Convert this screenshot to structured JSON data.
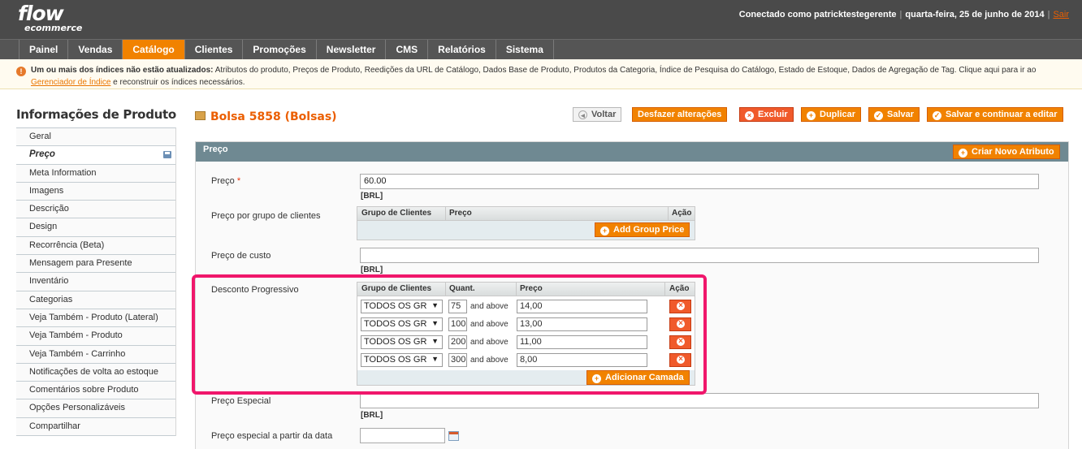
{
  "header": {
    "logo_top": "flow",
    "logo_bottom": "ecommerce",
    "user_text": "Conectado como patricktestegerente",
    "date_text": "quarta-feira, 25 de junho de 2014",
    "logout": "Sair"
  },
  "nav": {
    "items": [
      "Painel",
      "Vendas",
      "Catálogo",
      "Clientes",
      "Promoções",
      "Newsletter",
      "CMS",
      "Relatórios",
      "Sistema"
    ],
    "active": "Catálogo"
  },
  "notice": {
    "bold": "Um ou mais dos índices não estão atualizados:",
    "text": " Atributos do produto, Preços de Produto, Reedições da URL de Catálogo, Dados Base de Produto, Produtos da Categoria, Índice de Pesquisa do Catálogo, Estado de Estoque, Dados de Agregação de Tag. Clique aqui para ir ao ",
    "link": "Gerenciador de Índice",
    "after": " e reconstruir os índices necessários."
  },
  "sidebar": {
    "title": "Informações de Produto",
    "items": [
      "Geral",
      "Preço",
      "Meta Information",
      "Imagens",
      "Descrição",
      "Design",
      "Recorrência (Beta)",
      "Mensagem para Presente",
      "Inventário",
      "Categorias",
      "Veja Também - Produto (Lateral)",
      "Veja Também - Produto",
      "Veja Também - Carrinho",
      "Notificações de volta ao estoque",
      "Comentários sobre Produto",
      "Opções Personalizáveis",
      "Compartilhar"
    ]
  },
  "page": {
    "title": "Bolsa 5858 (Bolsas)",
    "buttons": {
      "back": "Voltar",
      "reset": "Desfazer alterações",
      "delete": "Excluir",
      "duplicate": "Duplicar",
      "save": "Salvar",
      "save_continue": "Salvar e continuar a editar"
    }
  },
  "section": {
    "title": "Preço",
    "create_attribute": "Criar Novo Atributo",
    "price_label": "Preço",
    "price_required": "*",
    "price_value": "60.00",
    "currency_note": "[BRL]",
    "group_price_label": "Preço por grupo de clientes",
    "group_price_headers": [
      "Grupo de Clientes",
      "Preço",
      "Ação"
    ],
    "add_group_price": "Add Group Price",
    "cost_label": "Preço de custo",
    "cost_value": "",
    "tier_label": "Desconto Progressivo",
    "tier_headers": [
      "Grupo de Clientes",
      "Quant.",
      "Preço",
      "Ação"
    ],
    "tier_rows": [
      {
        "group": "TODOS OS GR",
        "qty": "75",
        "above": "and above",
        "price": "14,00"
      },
      {
        "group": "TODOS OS GR",
        "qty": "100",
        "above": "and above",
        "price": "13,00"
      },
      {
        "group": "TODOS OS GR",
        "qty": "200",
        "above": "and above",
        "price": "11,00"
      },
      {
        "group": "TODOS OS GR",
        "qty": "300",
        "above": "and above",
        "price": "8,00"
      }
    ],
    "add_tier": "Adicionar Camada",
    "special_label": "Preço Especial",
    "special_value": "",
    "special_from_label": "Preço especial a partir da data",
    "special_from_value": ""
  },
  "colors": {
    "accent": "#f18200",
    "header_bg": "#4a4a4a",
    "section_head": "#6f8992",
    "highlight": "#f0166b"
  }
}
